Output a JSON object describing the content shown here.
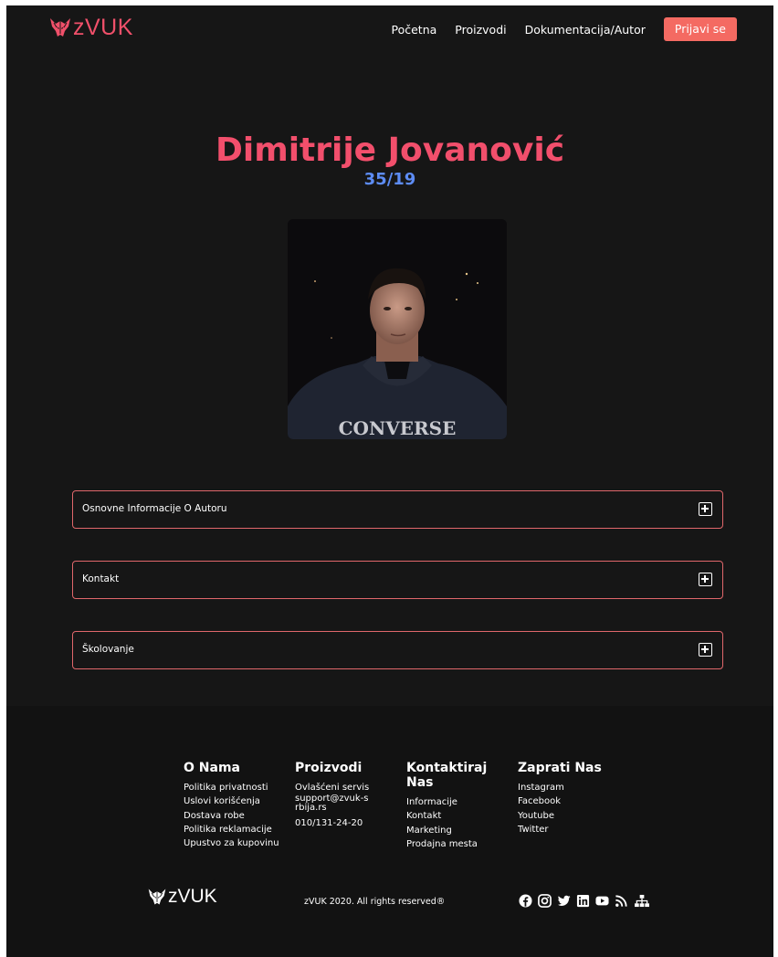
{
  "nav": {
    "logo_text": "zVUK",
    "links": [
      "Početna",
      "Proizvodi",
      "Dokumentacija/Autor"
    ],
    "login_label": "Prijavi se"
  },
  "hero": {
    "name": "Dimitrije Jovanović",
    "index": "35/19"
  },
  "accordion": [
    {
      "label": "Osnovne Informacije O Autoru"
    },
    {
      "label": "Kontakt"
    },
    {
      "label": "Školovanje"
    }
  ],
  "footer": {
    "columns": [
      {
        "title": "O Nama",
        "items": [
          "Politika privatnosti",
          "Uslovi korišćenja",
          "Dostava robe",
          "Politika reklamacije",
          "Upustvo za kupovinu"
        ]
      },
      {
        "title": "Proizvodi",
        "items": [
          "Ovlašćeni servis",
          "support@zvuk-srbija.rs",
          "010/131-24-20"
        ]
      },
      {
        "title": "Kontaktiraj Nas",
        "items": [
          "Informacije",
          "Kontakt",
          "Marketing",
          "Prodajna mesta"
        ]
      },
      {
        "title": "Zaprati Nas",
        "items": [
          "Instagram",
          "Facebook",
          "Youtube",
          "Twitter"
        ]
      }
    ],
    "logo_text": "zVUK",
    "copyright": "zVUK 2020. All rights reserved®",
    "social_icons": [
      "facebook-icon",
      "instagram-icon",
      "twitter-icon",
      "linkedin-icon",
      "youtube-icon",
      "rss-icon",
      "sitemap-icon"
    ]
  },
  "colors": {
    "accent": "#f24f6c",
    "button": "#f46a62",
    "subtitle": "#5d8cf4",
    "background": "#161616"
  }
}
